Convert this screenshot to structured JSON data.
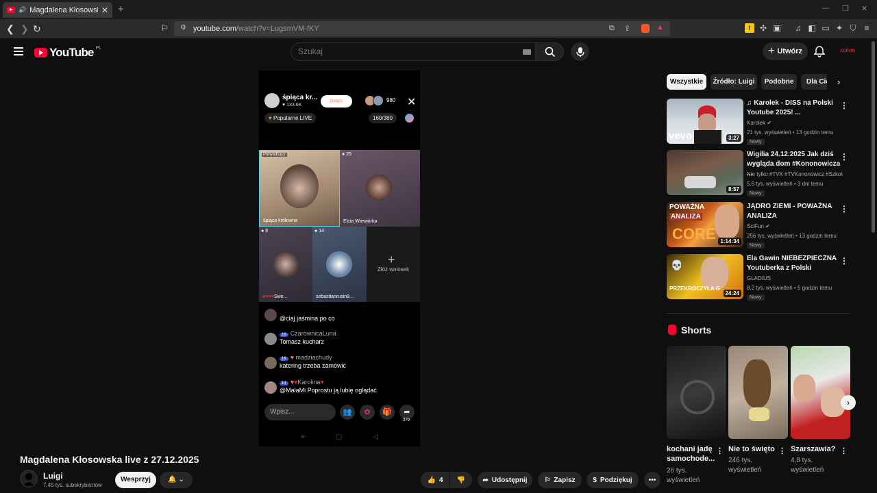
{
  "browser": {
    "tab_title": "Magdalena Kłosowska live z 2…",
    "url_host": "youtube.com",
    "url_path": "/watch?v=LugsmVM-fKY"
  },
  "header": {
    "logo_text": "YouTube",
    "country": "PL",
    "search_placeholder": "Szukaj",
    "create_label": "Utwórz",
    "avatar_text": "ADRON"
  },
  "stream": {
    "host_name": "śpiąca kr...",
    "host_likes": "♥ 133.6K",
    "join_label": "Dołącz",
    "viewer_count": "980",
    "badge_popular": "Popularne LIVE",
    "level_count": "160/380",
    "tiles": [
      {
        "name": "śpiąca królewna",
        "badge": "Prowadzący"
      },
      {
        "name": "Elcia Wiewiórka",
        "badge": "25"
      },
      {
        "name": "Swe...",
        "badge": "8"
      },
      {
        "name": "sebastianrusin9...",
        "badge": "14"
      }
    ],
    "request_label": "Złóż wniosek",
    "chat": [
      {
        "user": "",
        "level": "",
        "msg": "@ciaj jaśmina po co"
      },
      {
        "user": "CzarownicaLuna",
        "level": "16",
        "msg": "Tomasz kucharz"
      },
      {
        "user": "madziachudy",
        "level": "16",
        "msg": "katering trzeba zamówić"
      },
      {
        "user": "Karolina",
        "level": "14",
        "msg": "@MałaMi Poprostu ją lubię oglądać"
      }
    ],
    "input_placeholder": "Wpisz...",
    "share_count": "379"
  },
  "video": {
    "title": "Magdalena Kłosowska live z 27.12.2025",
    "channel": "Luigi",
    "subscribers": "7,45 tys. subskrybentów",
    "support_label": "Wesprzyj",
    "likes": "4",
    "share_label": "Udostępnij",
    "save_label": "Zapisz",
    "thanks_label": "Podziękuj"
  },
  "chips": [
    "Wszystkie",
    "Źródło: Luigi",
    "Podobne",
    "Dla Cie"
  ],
  "recommendations": [
    {
      "title": "♫ Karolek - DISS na Polski Youtube 2025! ...",
      "channel": "Karolek",
      "meta": "21 tys. wyświetleń • 13 godzin temu",
      "duration": "3:27",
      "badge": "Nowy"
    },
    {
      "title": "Wigilia 24.12.2025 Jak dziś wygląda dom #Kononowicza ...",
      "channel": "Nie tylko #TVK #TVKononowicz #Szkoln...",
      "meta": "5,6 tys. wyświetleń • 3 dni temu",
      "duration": "8:57",
      "badge": "Nowy"
    },
    {
      "title": "JĄDRO ZIEMI - POWAŻNA ANALIZA",
      "channel": "SciFun",
      "meta": "256 tys. wyświetleń • 13 godzin temu",
      "duration": "1:14:34",
      "badge": "Nowy"
    },
    {
      "title": "Ela Gawin NIEBEZPIECZNA Youtuberka z Polski",
      "channel": "GLADIUS",
      "meta": "8,2 tys. wyświetleń • 5 godzin temu",
      "duration": "24:24",
      "badge": "Nowy"
    }
  ],
  "thumb_text": {
    "vevo": "vevo",
    "analysis1": "POWAŻNA",
    "analysis2": "ANALIZA",
    "core": "CORE",
    "crossed": "PRZEKROCZYŁA G"
  },
  "shorts": {
    "heading": "Shorts",
    "items": [
      {
        "title": "kochani jadę samochode...",
        "views": "26 tys. wyświetleń"
      },
      {
        "title": "Nie to święto",
        "views": "246 tys. wyświetleń"
      },
      {
        "title": "Szarszawia?",
        "views": "4,8 tys. wyświetleń"
      }
    ]
  }
}
